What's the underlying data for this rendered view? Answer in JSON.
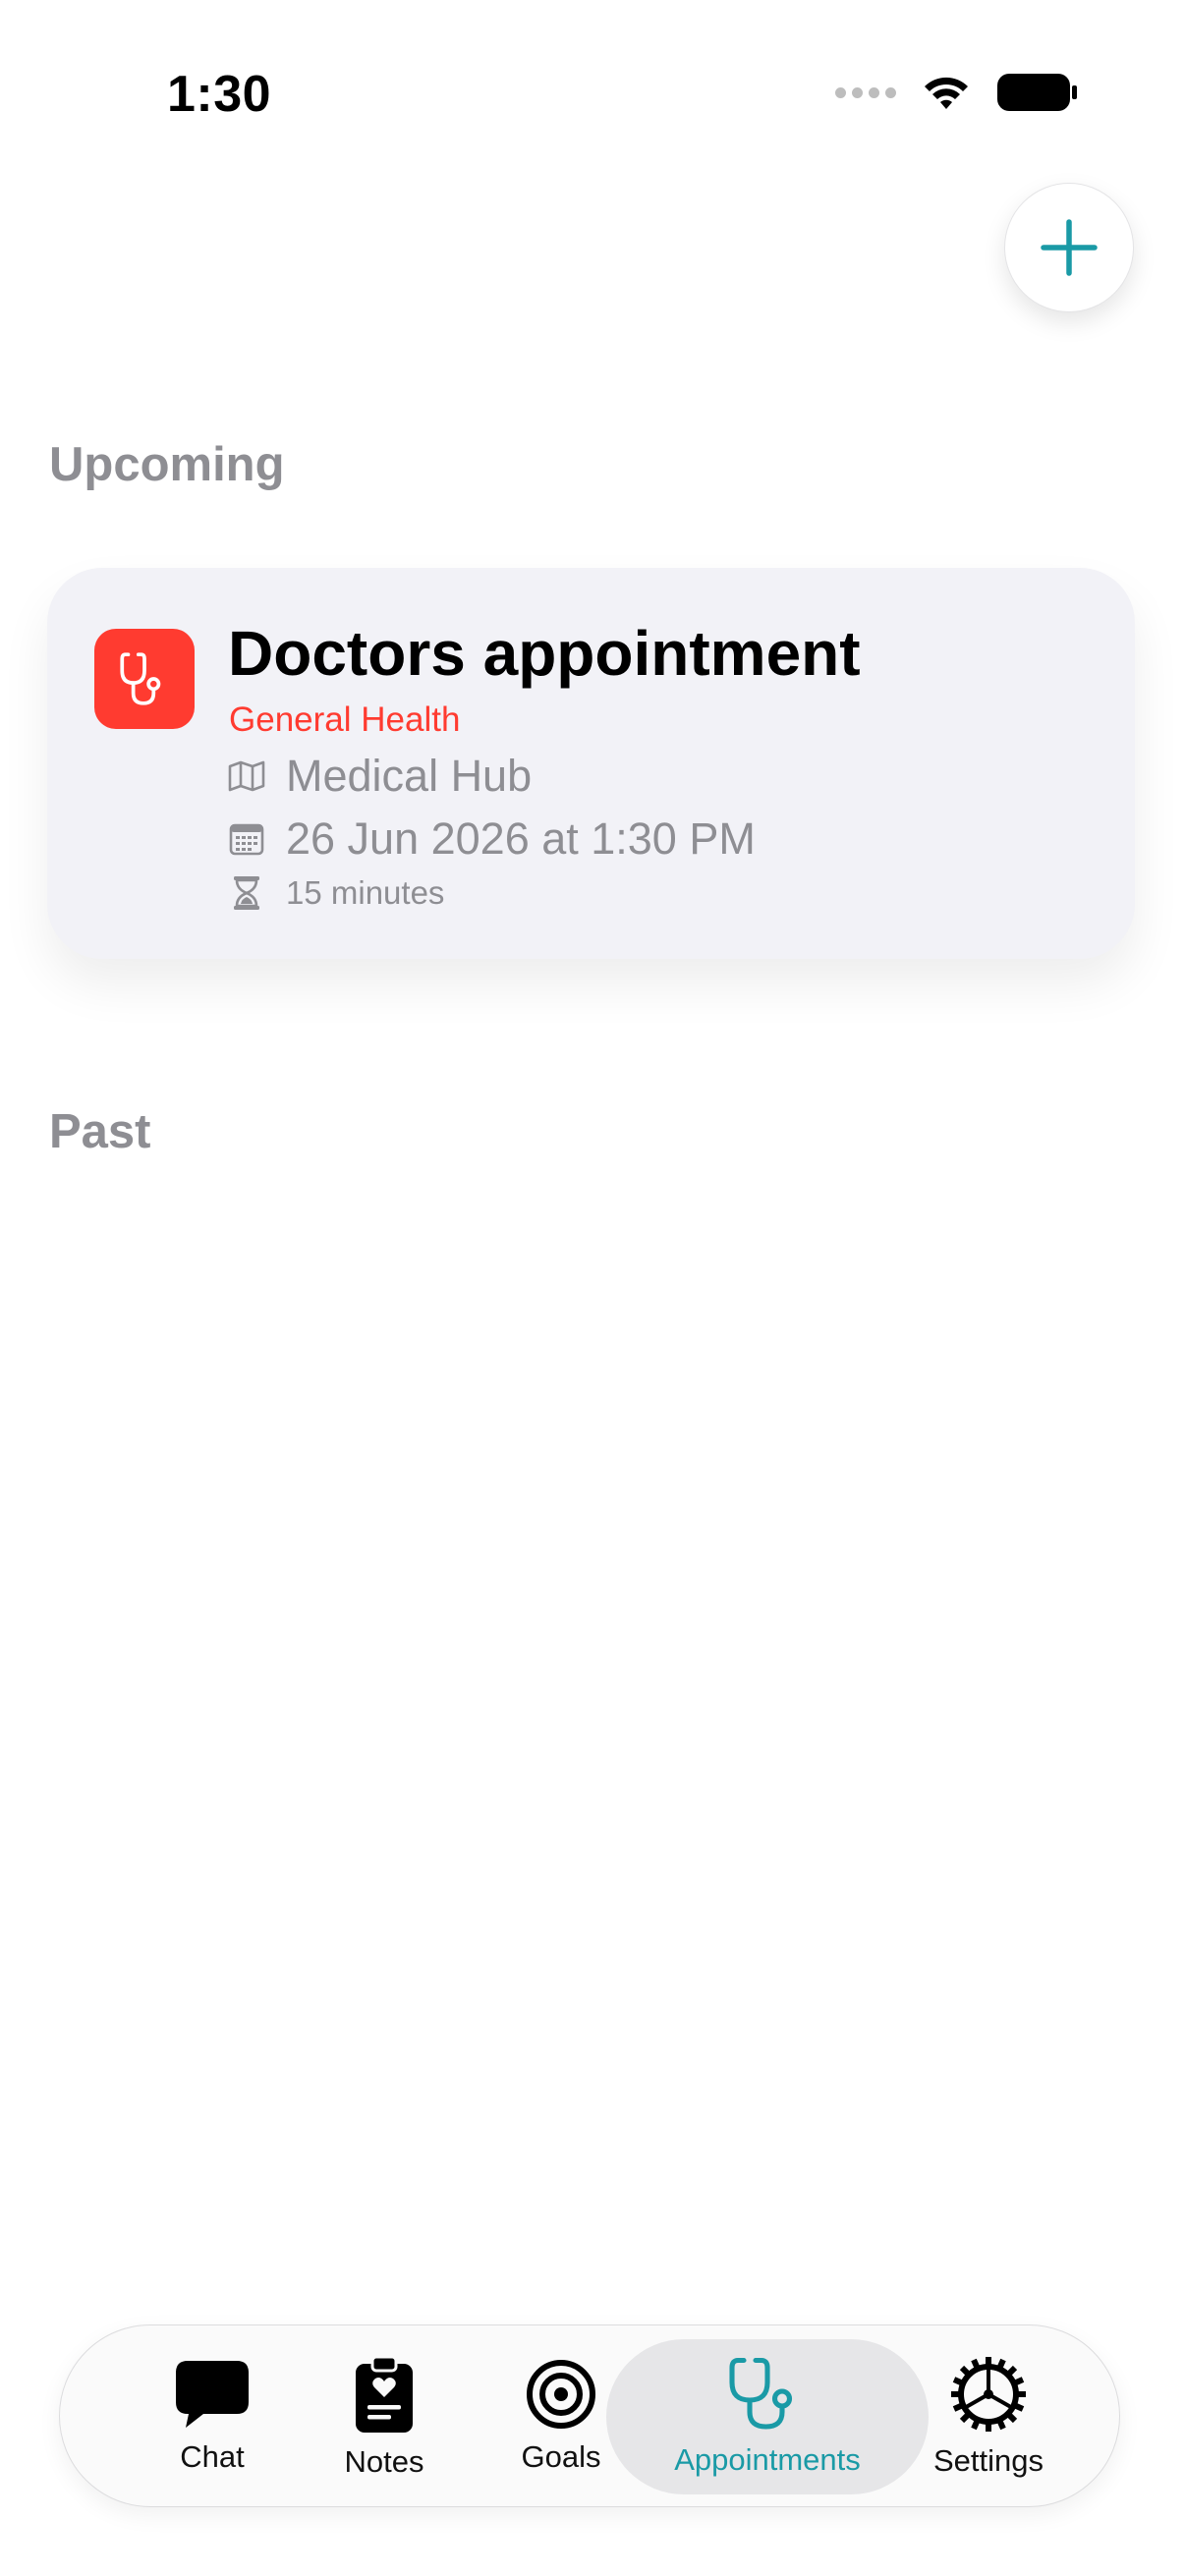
{
  "status_bar": {
    "time": "1:30"
  },
  "header": {
    "add_button_icon": "plus-icon",
    "accent_color": "#1a9aa6"
  },
  "sections": {
    "upcoming_title": "Upcoming",
    "past_title": "Past"
  },
  "upcoming": [
    {
      "icon": "stethoscope-icon",
      "icon_color": "#ff3b30",
      "title": "Doctors appointment",
      "category": "General Health",
      "location": "Medical Hub",
      "datetime": "26 Jun 2026 at 1:30 PM",
      "duration": "15 minutes"
    }
  ],
  "past": [],
  "tab_bar": {
    "active": "Appointments",
    "tabs": [
      {
        "label": "Chat",
        "icon": "chat-bubble-icon"
      },
      {
        "label": "Notes",
        "icon": "clipboard-heart-icon"
      },
      {
        "label": "Goals",
        "icon": "target-icon"
      },
      {
        "label": "Appointments",
        "icon": "stethoscope-icon"
      },
      {
        "label": "Settings",
        "icon": "gear-icon"
      }
    ]
  }
}
